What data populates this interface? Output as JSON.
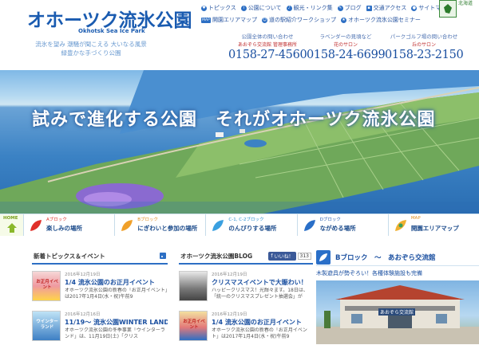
{
  "header": {
    "logo_title": "オホーツク流氷公園",
    "logo_sub": "Okhotsk Sea Ice Park",
    "tagline": [
      "流氷を望み 潮騒が聞こえる 大いなる風景",
      "緑豊かな手づくり公園"
    ],
    "seal_side_text": "北海道",
    "nav_row1": [
      {
        "label": "トピックス",
        "icon": "heart-icon"
      },
      {
        "label": "公園について",
        "icon": "info-icon"
      },
      {
        "label": "観光・リンク集",
        "icon": "music-note-icon"
      },
      {
        "label": "ブログ",
        "icon": "pencil-icon"
      },
      {
        "label": "交通アクセス",
        "icon": "car-icon"
      },
      {
        "label": "サイトマップ",
        "icon": "map-pin-icon"
      }
    ],
    "nav_row2": [
      {
        "label": "開園エリアマップ",
        "icon": "map-icon",
        "icon_text": "MAP"
      },
      {
        "label": "道の駅紹介ワークショップ",
        "icon": "person-icon"
      },
      {
        "label": "オホーツク流氷公園セミナー",
        "icon": "star-icon"
      }
    ],
    "contacts": [
      {
        "caption": "公園全体の問い合わせ",
        "sub": "あおぞら交流館 管理事務所",
        "tel": "0158-27-4560"
      },
      {
        "caption": "ラベンダーの見頃など",
        "sub": "花のサロン",
        "tel": "0158-24-6699"
      },
      {
        "caption": "パークゴルフ場の問い合わせ",
        "sub": "丘のサロン",
        "tel": "0158-23-2150"
      }
    ]
  },
  "hero": {
    "caption": "試みで進化する公園　それがオホーツク流氷公園"
  },
  "block_nav": {
    "home_label": "HOME",
    "items": [
      {
        "tag": "Aブロック",
        "name": "楽しみの場所",
        "tag_color": "#e0302a",
        "icon_color": "#e0302a"
      },
      {
        "tag": "Bブロック",
        "name": "にぎわいと参加の場所",
        "tag_color": "#e08a1a",
        "icon_color": "#f0a02a"
      },
      {
        "tag": "C-1, C-2ブロック",
        "name": "のんびりする場所",
        "tag_color": "#2d8fd0",
        "icon_color": "#3aa0e0"
      },
      {
        "tag": "Dブロック",
        "name": "ながめる場所",
        "tag_color": "#2a5fb0",
        "icon_color": "#2a6fc8"
      },
      {
        "tag": "MAP",
        "name": "開園エリアマップ",
        "tag_color": "#e09020",
        "icon_color": "#f0b030"
      }
    ]
  },
  "news": {
    "title": "新着トピックス＆イベント",
    "items": [
      {
        "date": "2016年12月19日",
        "title": "1/4 流氷公園のお正月イベント",
        "text": "オホーツク流氷公園の新春の「お正月イベント」は2017年1月4日(水・祝)午前9",
        "thumb_text": "お正月イベント"
      },
      {
        "date": "2016年12月16日",
        "title": "11/19～ 流氷公園WINTER LAND",
        "text": "オホーツク流氷公園の冬季事業「ウインターランド」は、11月19日(土)「クリス",
        "thumb_text": "ウインターランド"
      }
    ]
  },
  "blog": {
    "title": "オホーツク流氷公園BLOG",
    "like_label": "いいね！",
    "like_count": "313",
    "items": [
      {
        "date": "2016年12月19日",
        "title": "クリスマスイベントで大賑わい！",
        "text": "ハッピークリスマス！光輝々ます。18日は、「統一のクリスマスプレゼント抽選会」が"
      },
      {
        "date": "2016年12月19日",
        "title": "1/4 流氷公園のお正月イベント",
        "text": "オホーツク流氷公園の新春の「お正月イベント」は2017年1月4日(水・祝)午前9",
        "thumb_text": "お正月イベント"
      }
    ]
  },
  "block_b": {
    "title": "Bブロック　～　あおぞら交流館",
    "subtitle": "木製遊具が勢ぞろい！各種体験施設も完備",
    "sign_text": "あおぞら交流館"
  },
  "colors": {
    "brand_blue": "#1a5bb0",
    "link_blue": "#1a4fa0",
    "accent_red": "#e0302a"
  }
}
